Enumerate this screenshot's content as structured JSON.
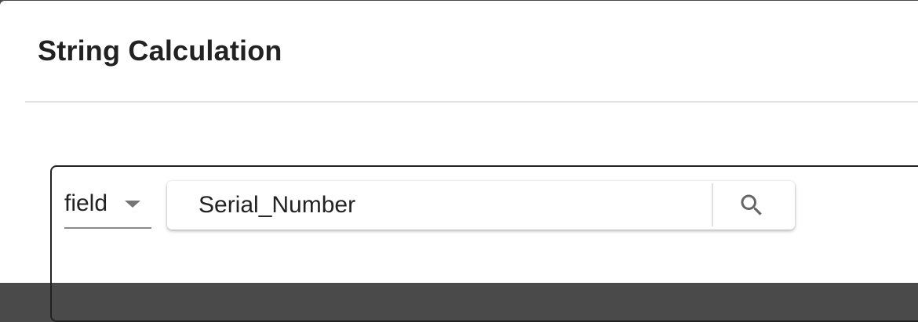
{
  "dialog": {
    "title": "String Calculation"
  },
  "filter": {
    "field_select": {
      "selected": "field"
    },
    "search": {
      "value": "Serial_Number",
      "icon": "search-icon"
    }
  },
  "colors": {
    "text": "#222222",
    "divider": "#e3e3e3",
    "panel_border": "#222222",
    "icon": "#666666"
  }
}
